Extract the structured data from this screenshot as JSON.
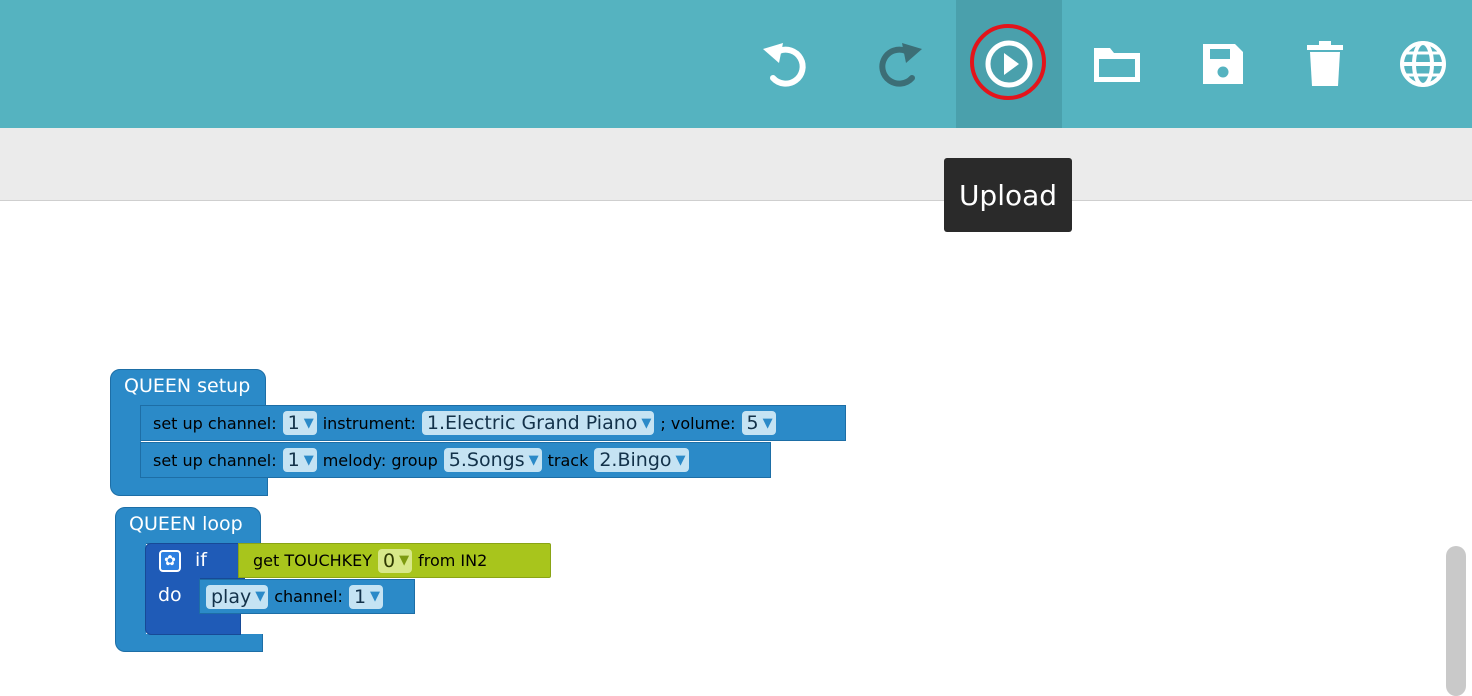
{
  "toolbar": {
    "buttons": [
      {
        "name": "undo",
        "icon": "undo-icon"
      },
      {
        "name": "redo",
        "icon": "redo-icon"
      },
      {
        "name": "upload",
        "icon": "play-circle-icon"
      },
      {
        "name": "open",
        "icon": "folder-icon"
      },
      {
        "name": "save",
        "icon": "save-icon"
      },
      {
        "name": "delete",
        "icon": "trash-icon"
      },
      {
        "name": "language",
        "icon": "globe-icon"
      }
    ],
    "tooltip": "Upload",
    "colors": {
      "bar": "#55b3c0",
      "active": "#4aa0ac",
      "highlight": "#e3141b"
    }
  },
  "blocks": {
    "setup": {
      "title": "QUEEN setup",
      "line1": {
        "prefix": "set up channel:",
        "channel": "1",
        "instrument_label": "instrument:",
        "instrument": "1.Electric Grand Piano",
        "volume_label": "; volume:",
        "volume": "5"
      },
      "line2": {
        "prefix": "set up channel:",
        "channel": "1",
        "melody_label": "melody: group",
        "group": "5.Songs",
        "track_label": "track",
        "track": "2.Bingo"
      }
    },
    "loop": {
      "title": "QUEEN loop",
      "if_label": "if",
      "do_label": "do",
      "condition": {
        "prefix": "get TOUCHKEY",
        "key": "0",
        "suffix": "from IN2"
      },
      "play": {
        "action": "play",
        "channel_label": "channel:",
        "channel": "1"
      }
    },
    "colors": {
      "statement": "#2b8ac8",
      "control": "#1f5bb7",
      "sensor": "#a8c51c"
    }
  }
}
